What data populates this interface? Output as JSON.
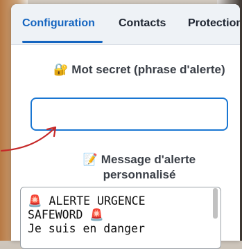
{
  "tabs": [
    {
      "label": "Configuration"
    },
    {
      "label": "Contacts"
    },
    {
      "label": "Protection"
    }
  ],
  "safeword": {
    "icon": "🔐",
    "label": "Mot secret (phrase d'alerte)",
    "value": ""
  },
  "message": {
    "icon": "📝",
    "label": "Message d'alerte personnalisé",
    "value": "🚨 ALERTE URGENCE\nSAFEWORD 🚨\nJe suis en danger"
  },
  "colors": {
    "accent": "#1565c0",
    "annotation": "#c62828"
  }
}
